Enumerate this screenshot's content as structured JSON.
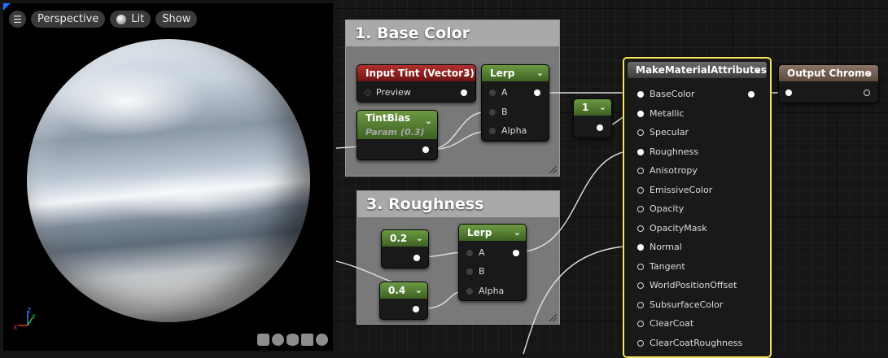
{
  "viewport": {
    "toolbar": {
      "perspective": "Perspective",
      "lit": "Lit",
      "show": "Show"
    },
    "axis": {
      "x": "X",
      "y": "Y",
      "z": "Z"
    }
  },
  "comments": {
    "base_color": "1. Base Color",
    "roughness": "3. Roughness"
  },
  "nodes": {
    "input_tint": {
      "title": "Input Tint (Vector3)",
      "pin": "Preview"
    },
    "tint_bias": {
      "title": "TintBias",
      "subtitle": "Param (0.3)"
    },
    "lerp_top": {
      "title": "Lerp",
      "a": "A",
      "b": "B",
      "alpha": "Alpha"
    },
    "const_one": {
      "title": "1"
    },
    "const_02": {
      "title": "0.2"
    },
    "const_04": {
      "title": "0.4"
    },
    "lerp_bottom": {
      "title": "Lerp",
      "a": "A",
      "b": "B",
      "alpha": "Alpha"
    },
    "make_attrs": {
      "title": "MakeMaterialAttributes",
      "pins": [
        "BaseColor",
        "Metallic",
        "Specular",
        "Roughness",
        "Anisotropy",
        "EmissiveColor",
        "Opacity",
        "OpacityMask",
        "Normal",
        "Tangent",
        "WorldPositionOffset",
        "SubsurfaceColor",
        "ClearCoat",
        "ClearCoatRoughness"
      ]
    },
    "output": {
      "title": "Output Chrome"
    }
  },
  "colors": {
    "selection": "#f4e55a",
    "accent": "#1f6fff"
  }
}
